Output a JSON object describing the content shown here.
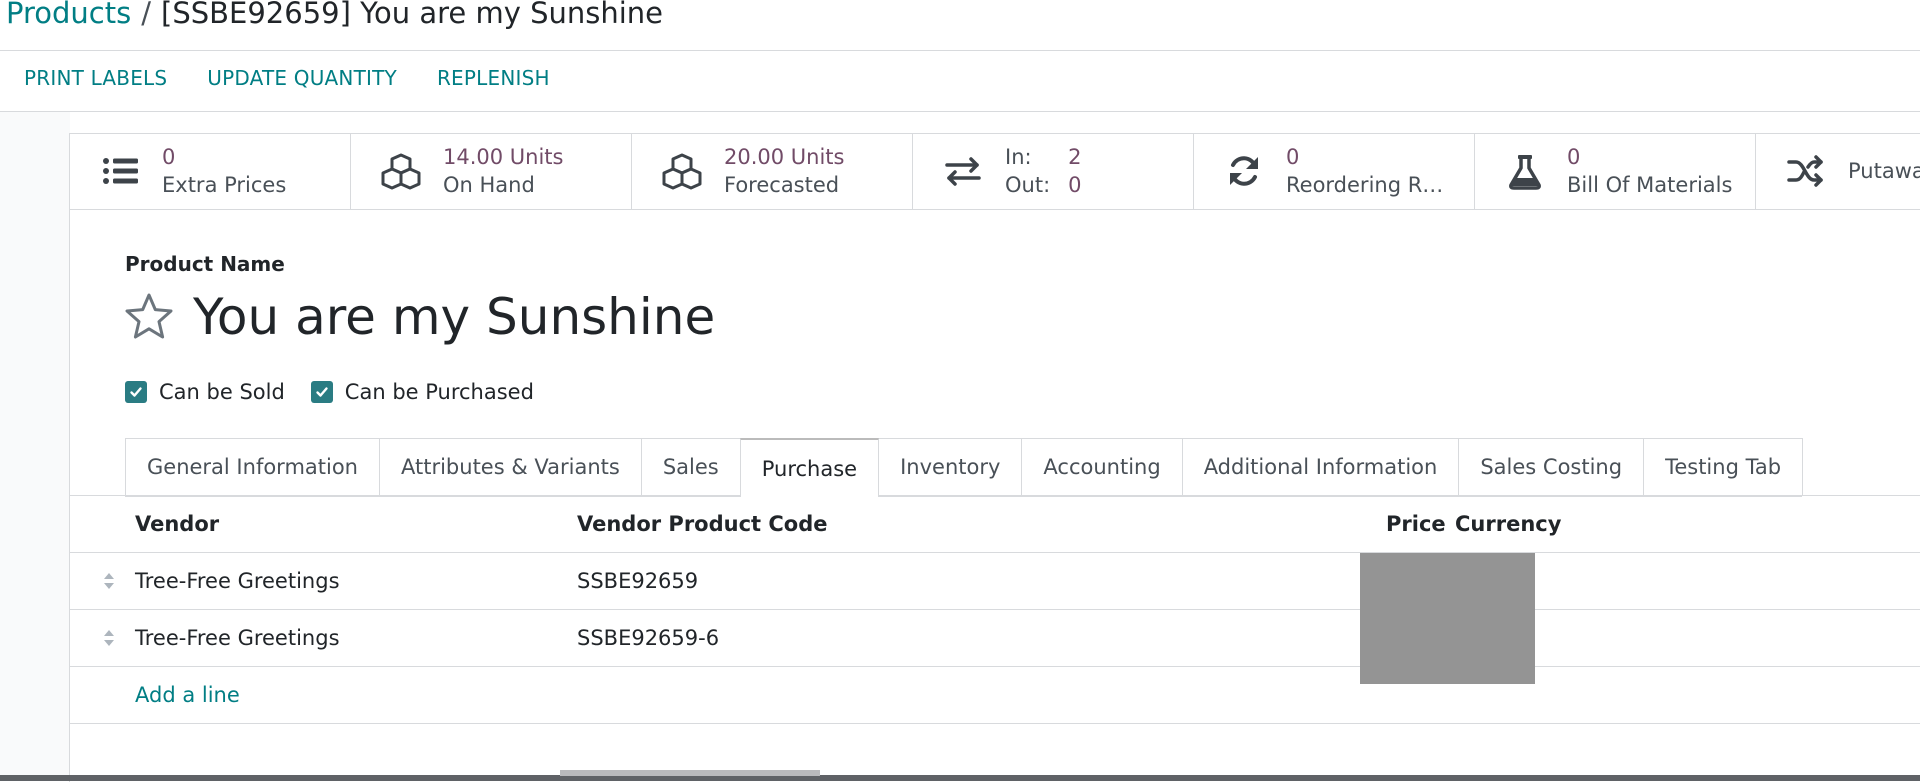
{
  "breadcrumb": {
    "parent": "Products",
    "separator": "/",
    "current": "[SSBE92659] You are my Sunshine"
  },
  "actions": [
    "PRINT LABELS",
    "UPDATE QUANTITY",
    "REPLENISH"
  ],
  "smart_buttons": {
    "extra_prices": {
      "value": "0",
      "label": "Extra Prices",
      "icon": "list-icon"
    },
    "on_hand": {
      "value": "14.00 Units",
      "label": "On Hand",
      "icon": "cubes-icon"
    },
    "forecasted": {
      "value": "20.00 Units",
      "label": "Forecasted",
      "icon": "cubes-icon"
    },
    "in_out": {
      "in_label": "In:",
      "in_value": "2",
      "out_label": "Out:",
      "out_value": "0",
      "icon": "arrows-exchange-icon"
    },
    "reordering": {
      "value": "0",
      "label": "Reordering R…",
      "icon": "refresh-icon"
    },
    "bom": {
      "value": "0",
      "label": "Bill Of Materials",
      "icon": "flask-icon"
    },
    "putaway": {
      "label": "Putawa",
      "icon": "shuffle-icon"
    }
  },
  "form": {
    "product_name_label": "Product Name",
    "product_name": "You are my Sunshine",
    "can_be_sold": "Can be Sold",
    "can_be_purchased": "Can be Purchased"
  },
  "tabs": [
    {
      "label": "General Information"
    },
    {
      "label": "Attributes & Variants"
    },
    {
      "label": "Sales"
    },
    {
      "label": "Purchase",
      "active": true
    },
    {
      "label": "Inventory"
    },
    {
      "label": "Accounting"
    },
    {
      "label": "Additional Information"
    },
    {
      "label": "Sales Costing"
    },
    {
      "label": "Testing Tab"
    }
  ],
  "vendor_table": {
    "headers": {
      "vendor": "Vendor",
      "code": "Vendor Product Code",
      "price": "Price",
      "currency": "Currency"
    },
    "rows": [
      {
        "vendor": "Tree-Free Greetings",
        "code": "SSBE92659"
      },
      {
        "vendor": "Tree-Free Greetings",
        "code": "SSBE92659-6"
      }
    ],
    "add_line": "Add a line"
  },
  "colors": {
    "link": "#017e84",
    "value": "#714b67",
    "checkbox": "#2a7c83",
    "redacted": "#949494"
  }
}
